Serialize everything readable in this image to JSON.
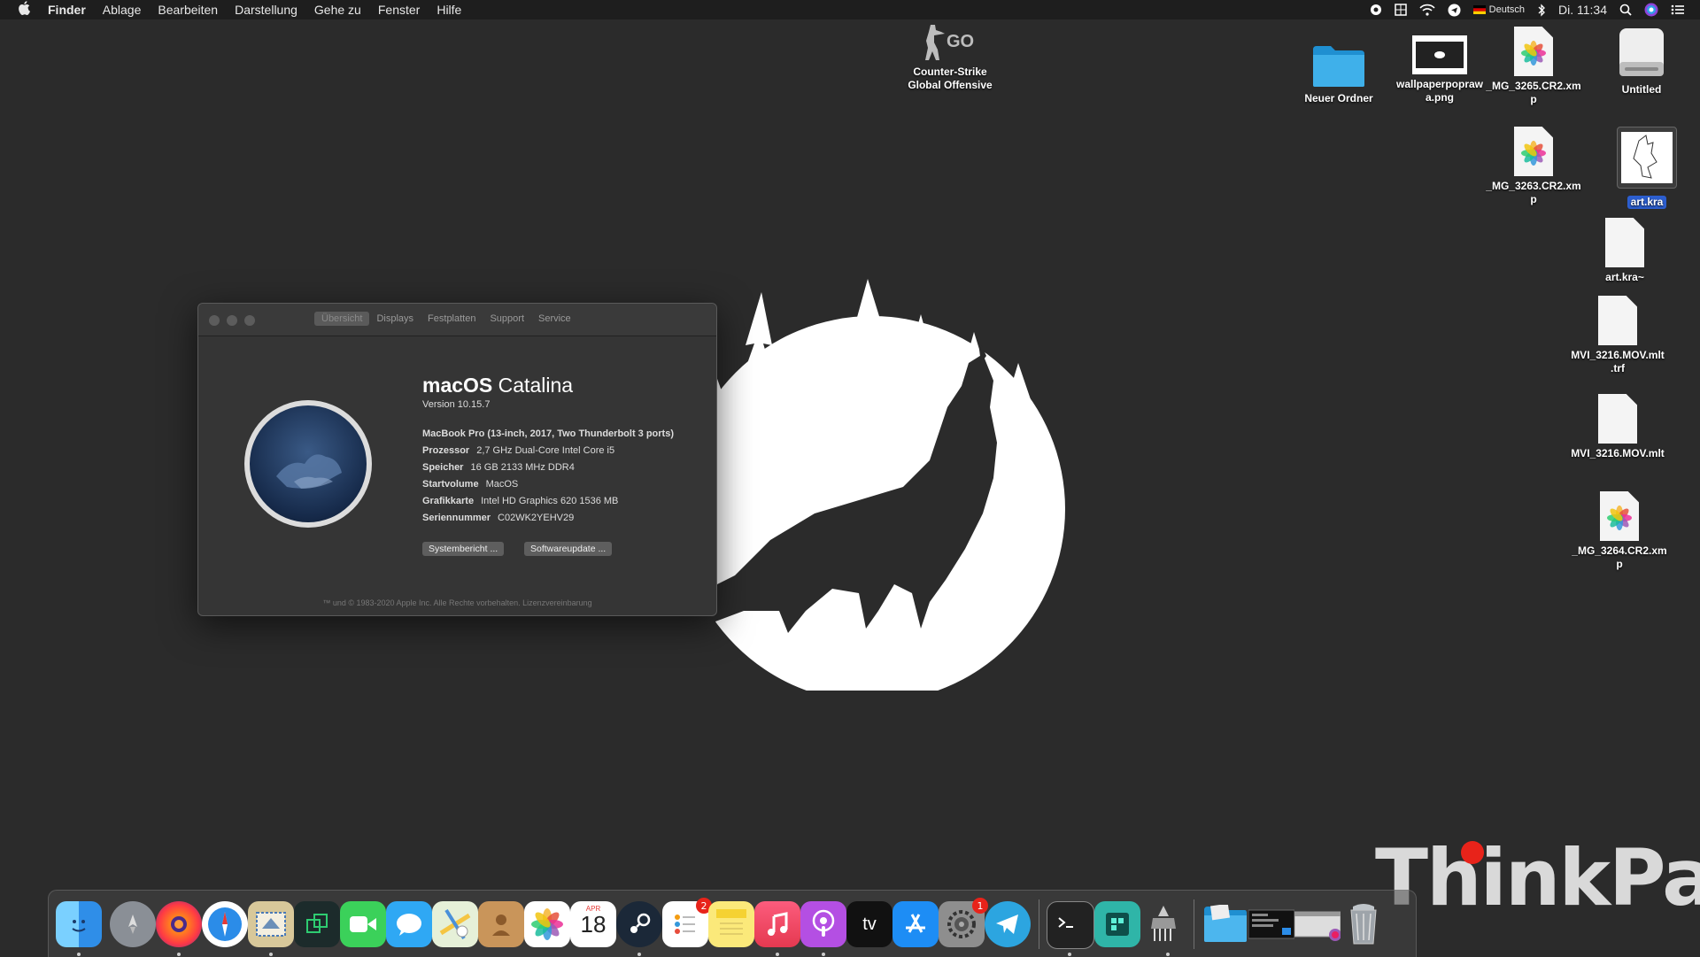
{
  "menubar": {
    "apple": "",
    "app_name": "Finder",
    "menus": [
      "Ablage",
      "Bearbeiten",
      "Darstellung",
      "Gehe zu",
      "Fenster",
      "Hilfe"
    ],
    "input_source": "Deutsch",
    "clock": "Di. 11:34"
  },
  "desktop_icons": [
    {
      "name": "Counter-Strike Global Offensive",
      "label": "Counter-Strike\nGlobal Offensive",
      "logo_text": "GO"
    },
    {
      "name": "Neuer Ordner",
      "label": "Neuer Ordner"
    },
    {
      "name": "wallpaperpoprawka.png",
      "label": "wallpaperpopraw\na.png"
    },
    {
      "name": "_MG_3265.CR2.xmp",
      "label": "_MG_3265.CR2.xm\np"
    },
    {
      "name": "Untitled",
      "label": "Untitled"
    },
    {
      "name": "_MG_3263.CR2.xmp",
      "label": "_MG_3263.CR2.xm\np"
    },
    {
      "name": "art.kra",
      "label": "art.kra"
    },
    {
      "name": "art.kra~",
      "label": "art.kra~"
    },
    {
      "name": "MVI_3216.MOV.mlt.trf",
      "label": "MVI_3216.MOV.mlt\n.trf"
    },
    {
      "name": "MVI_3216.MOV.mlt",
      "label": "MVI_3216.MOV.mlt"
    },
    {
      "name": "_MG_3264.CR2.xmp",
      "label": "_MG_3264.CR2.xm\np"
    }
  ],
  "about_window": {
    "tabs": [
      "Übersicht",
      "Displays",
      "Festplatten",
      "Support",
      "Service"
    ],
    "active_tab": "Übersicht",
    "os_name_bold": "macOS",
    "os_name": "Catalina",
    "version": "Version 10.15.7",
    "model": "MacBook Pro (13-inch, 2017, Two Thunderbolt 3 ports)",
    "specs": [
      {
        "key": "Prozessor",
        "value": "2,7 GHz Dual-Core Intel Core i5"
      },
      {
        "key": "Speicher",
        "value": "16 GB 2133 MHz DDR4"
      },
      {
        "key": "Startvolume",
        "value": "MacOS"
      },
      {
        "key": "Grafikkarte",
        "value": "Intel HD Graphics 620 1536 MB"
      },
      {
        "key": "Seriennummer",
        "value": "C02WK2YEHV29"
      }
    ],
    "buttons": {
      "system_report": "Systembericht ...",
      "software_update": "Softwareupdate ..."
    },
    "copyright": "™ und © 1983-2020 Apple Inc. Alle Rechte vorbehalten. Lizenzvereinbarung"
  },
  "wallpaper_text": "ThinkPad",
  "dock": {
    "calendar_month": "APR",
    "calendar_day": "18",
    "appletv_label": "tv",
    "reminders_badge": "2",
    "sysprefs_badge": "1",
    "items": [
      "Finder",
      "Launchpad",
      "Firefox",
      "Safari",
      "Mail",
      "Parallels",
      "FaceTime",
      "Messages",
      "Maps",
      "Contacts",
      "Photos",
      "Calendar",
      "Steam",
      "Reminders",
      "Notes",
      "Music",
      "Podcasts",
      "TV",
      "App Store",
      "System Preferences",
      "Telegram",
      "Terminal",
      "Krita",
      "Automator",
      "Downloads",
      "Screenshots",
      "Recent",
      "Trash"
    ]
  }
}
